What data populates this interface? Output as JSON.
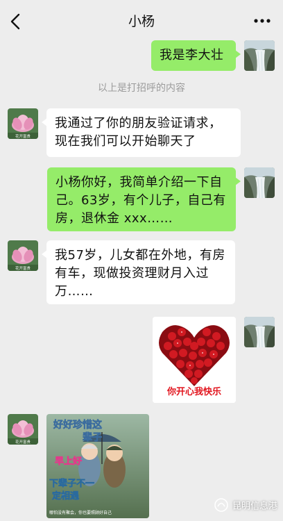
{
  "header": {
    "title": "小杨",
    "back_icon": "chevron-left-icon",
    "more_icon": "more-dots-icon"
  },
  "system_message": "以上是打招呼的内容",
  "messages": [
    {
      "from": "me",
      "text": "我是李大壮"
    },
    {
      "from": "contact",
      "text": "我通过了你的朋友验证请求，现在我们可以开始聊天了"
    },
    {
      "from": "me",
      "text": "小杨你好，我简单介绍一下自己。63岁，有个儿子，自己有房，退休金 xxx……"
    },
    {
      "from": "contact",
      "text": "我57岁，儿女都在外地，有房有车，现做投资理财月入过万……"
    },
    {
      "from": "me",
      "type": "image",
      "caption": "你开心我快乐"
    },
    {
      "from": "contact",
      "type": "image",
      "lines": [
        "好好珍惜这",
        "辈子",
        "早上好",
        "下辈子不一",
        "定相遇"
      ],
      "footer": "哪怕没有聚会，你也要照顾好自己"
    }
  ],
  "contact_avatar_label": "花开富贵",
  "watermark": "昆明信息港",
  "colors": {
    "background": "#ededed",
    "my_bubble": "#95ec69",
    "contact_bubble": "#ffffff",
    "system_text": "#9b9b9b"
  }
}
